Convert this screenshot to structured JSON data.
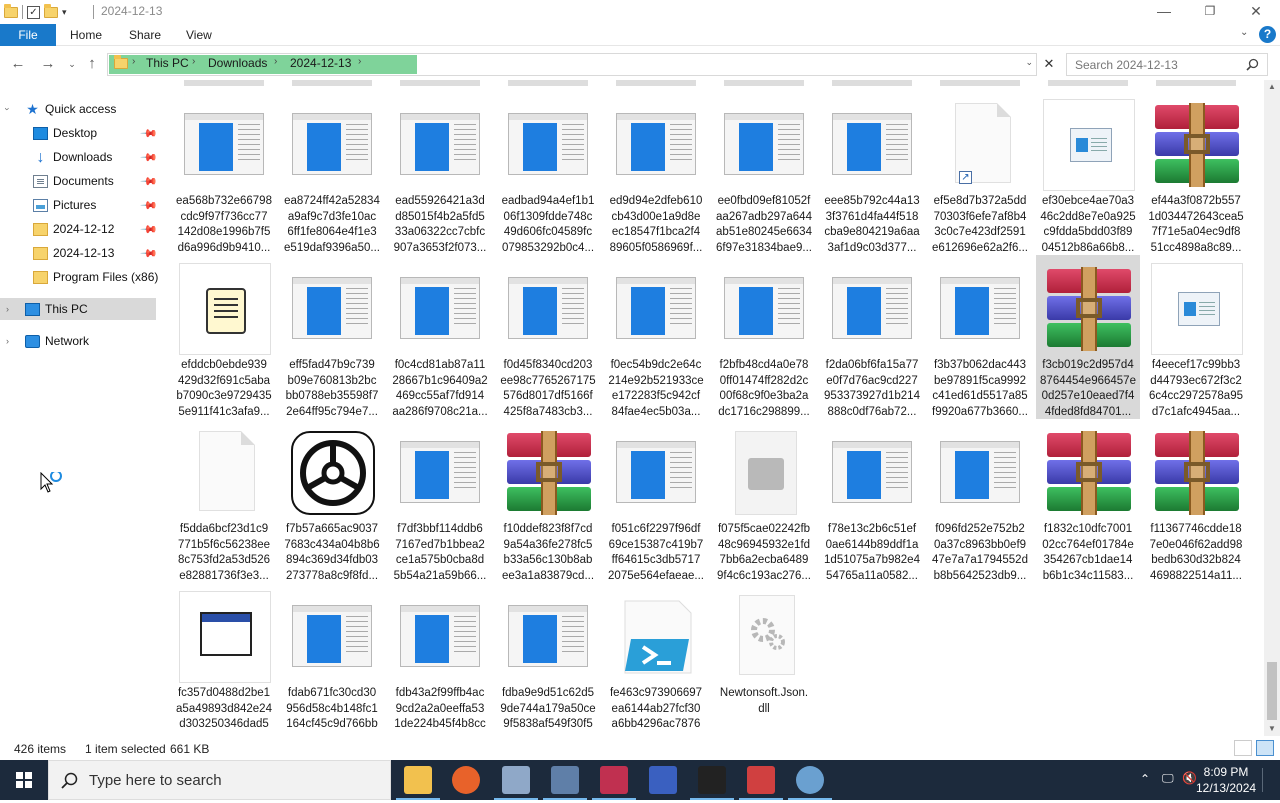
{
  "window": {
    "title": "2024-12-13",
    "controls": {
      "minimize": "—",
      "maximize": "❐",
      "close": "✕"
    }
  },
  "ribbon": {
    "tabs": [
      "File",
      "Home",
      "Share",
      "View"
    ],
    "expand_glyph": "⌄",
    "help": "?"
  },
  "address": {
    "crumbs": [
      "This PC",
      "Downloads",
      "2024-12-13"
    ],
    "separator": "›"
  },
  "search": {
    "placeholder": "Search 2024-12-13"
  },
  "nav": {
    "quick_access": "Quick access",
    "items": [
      {
        "label": "Desktop",
        "icon": "desktop-icon",
        "pinned": true
      },
      {
        "label": "Downloads",
        "icon": "downloads-icon",
        "pinned": true
      },
      {
        "label": "Documents",
        "icon": "documents-icon",
        "pinned": true
      },
      {
        "label": "Pictures",
        "icon": "pictures-icon",
        "pinned": true
      },
      {
        "label": "2024-12-12",
        "icon": "folder-icon",
        "pinned": true
      },
      {
        "label": "2024-12-13",
        "icon": "folder-icon",
        "pinned": true
      },
      {
        "label": "Program Files (x86)",
        "icon": "folder-icon",
        "pinned": false
      }
    ],
    "this_pc": "This PC",
    "network": "Network"
  },
  "files": [
    {
      "name": "ea568b732e66798\ncdc9f97f736cc77\n142d08e1996b7f5\nd6a996d9b9410...",
      "type": "window"
    },
    {
      "name": "ea8724ff42a52834\na9af9c7d3fe10ac\n6ff1fe8064e4f1e3\ne519daf9396a50...",
      "type": "window"
    },
    {
      "name": "ead55926421a3d\nd85015f4b2a5fd5\n33a06322cc7cbfc\n907a3653f2f073...",
      "type": "window"
    },
    {
      "name": "eadbad94a4ef1b1\n06f1309fdde748c\n49d606fc04589fc\n079853292b0c4...",
      "type": "window"
    },
    {
      "name": "ed9d94e2dfeb610\ncb43d00e1a9d8e\nec18547f1bca2f4\n89605f0586969f...",
      "type": "window"
    },
    {
      "name": "ee0fbd09ef81052f\naa267adb297a644\nab51e80245e6634\n6f97e31834bae9...",
      "type": "window"
    },
    {
      "name": "eee85b792c44a13\n3f3761d4fa44f518\ncba9e804219a6aa\n3af1d9c03d377...",
      "type": "window"
    },
    {
      "name": "ef5e8d7b372a5dd\n70303f6efe7af8b4\n3c0c7e423df2591\ne612696e62a2f6...",
      "type": "shortcut"
    },
    {
      "name": "ef30ebce4ae70a3\n46c2dd8e7e0a925\nc9fdda5bdd03f89\n04512b86a66b8...",
      "type": "preview"
    },
    {
      "name": "ef44a3f0872b557\n1d034472643cea5\n7f71e5a04ec9df8\n51cc4898a8c89...",
      "type": "rar"
    },
    {
      "name": "efddcb0ebde939\n429d32f691c5aba\nb7090c3e9729435\n5e911f41c3afa9...",
      "type": "script"
    },
    {
      "name": "eff5fad47b9c739\nb09e760813b2bc\nbb0788eb35598f7\n2e64ff95c794e7...",
      "type": "window"
    },
    {
      "name": "f0c4cd81ab87a11\n28667b1c96409a2\n469cc55af7fd914\naa286f9708c21a...",
      "type": "window"
    },
    {
      "name": "f0d45f8340cd203\nee98c7765267175\n576d8017df5166f\n425f8a7483cb3...",
      "type": "window"
    },
    {
      "name": "f0ec54b9dc2e64c\n214e92b521933ce\ne172283f5c942cf\n84fae4ec5b03a...",
      "type": "window"
    },
    {
      "name": "f2bfb48cd4a0e78\n0ff01474ff282d2c\n00f68c9f0e3ba2a\ndc1716c298899...",
      "type": "window"
    },
    {
      "name": "f2da06bf6fa15a77\ne0f7d76ac9cd227\n953373927d1b214\n888c0df76ab72...",
      "type": "window"
    },
    {
      "name": "f3b37b062dac443\nbe97891f5ca9992\nc41ed61d5517a85\nf9920a677b3660...",
      "type": "window"
    },
    {
      "name": "f3cb019c2d957d4\n8764454e966457e\n0d257e10eaed7f4\n4fded8fd84701...",
      "type": "rar",
      "selected": true
    },
    {
      "name": "f4eecef17c99bb3\nd44793ec672f3c2\n6c4cc2972578a95\nd7c1afc4945aa...",
      "type": "preview"
    },
    {
      "name": "f5dda6bcf23d1c9\n771b5f6c56238ee\n8c753fd2a53d526\ne82881736f3e3...",
      "type": "blank"
    },
    {
      "name": "f7b57a665ac9037\n7683c434a04b8b6\n894c369d34fdb03\n273778a8c9f8fd...",
      "type": "logo"
    },
    {
      "name": "f7df3bbf114ddb6\n7167ed7b1bbea2\nce1a575b0cba8d\n5b54a21a59b66...",
      "type": "window"
    },
    {
      "name": "f10ddef823f8f7cd\n9a54a36fe278fc5\nb33a56c130b8ab\nee3a1a83879cd...",
      "type": "rar"
    },
    {
      "name": "f051c6f2297f96df\n69ce15387c419b7\nff64615c3db5717\n2075e564efaeae...",
      "type": "window"
    },
    {
      "name": "f075f5cae02242fb\n48c96945932e1fd\n7bb6a2ecba6489\n9f4c6c193ac276...",
      "type": "gray"
    },
    {
      "name": "f78e13c2b6c51ef\n0ae6144b89ddf1a\n1d51075a7b982e4\n54765a11a0582...",
      "type": "window"
    },
    {
      "name": "f096fd252e752b2\n0a37c8963bb0ef9\n47e7a7a1794552d\nb8b5642523db9...",
      "type": "window"
    },
    {
      "name": "f1832c10dfc7001\n02cc764ef01784e\n354267cb1dae14\nb6b1c34c11583...",
      "type": "rar"
    },
    {
      "name": "f11367746cdde18\n7e0e046f62add98\nbedb630d32b824\n4698822514a11...",
      "type": "rar"
    },
    {
      "name": "fc357d0488d2be1\na5a49893d842e24\nd303250346dad5\n92f6b1c8a9511...",
      "type": "app"
    },
    {
      "name": "fdab671fc30cd30\n956d58c4b148fc1\n164cf45c9d766bb\n0e5b34f144b40...",
      "type": "window"
    },
    {
      "name": "fdb43a2f99ffb4ac\n9cd2a2a0eeffa53\n1de224b45f4b8cc\ne0bd700a89f1f5...",
      "type": "window"
    },
    {
      "name": "fdba9e9d51c62d5\n9de744a179a50ce\n9f5838af549f30f5\nb87c8175dace0...",
      "type": "window"
    },
    {
      "name": "fe463c973906697\nea6144ab27fcf30\na6bb4296ac7876\nd3d69b466679...",
      "type": "powershell"
    },
    {
      "name": "Newtonsoft.Json.\ndll",
      "type": "dll"
    }
  ],
  "status": {
    "count": "426 items",
    "selected": "1 item selected",
    "size": "661 KB"
  },
  "taskbar": {
    "search_placeholder": "Type here to search",
    "time": "8:09 PM",
    "date": "12/13/2024",
    "apps": [
      "file-explorer-icon",
      "firefox-icon",
      "app-icon",
      "app-icon",
      "winrar-icon",
      "app-icon",
      "terminal-icon",
      "app-icon",
      "app-icon"
    ]
  },
  "colors": {
    "file_tab": "#1979ca",
    "address_highlight": "#7fd39a",
    "taskbar": "#1c2a3c",
    "selection": "#d9d9d9"
  }
}
